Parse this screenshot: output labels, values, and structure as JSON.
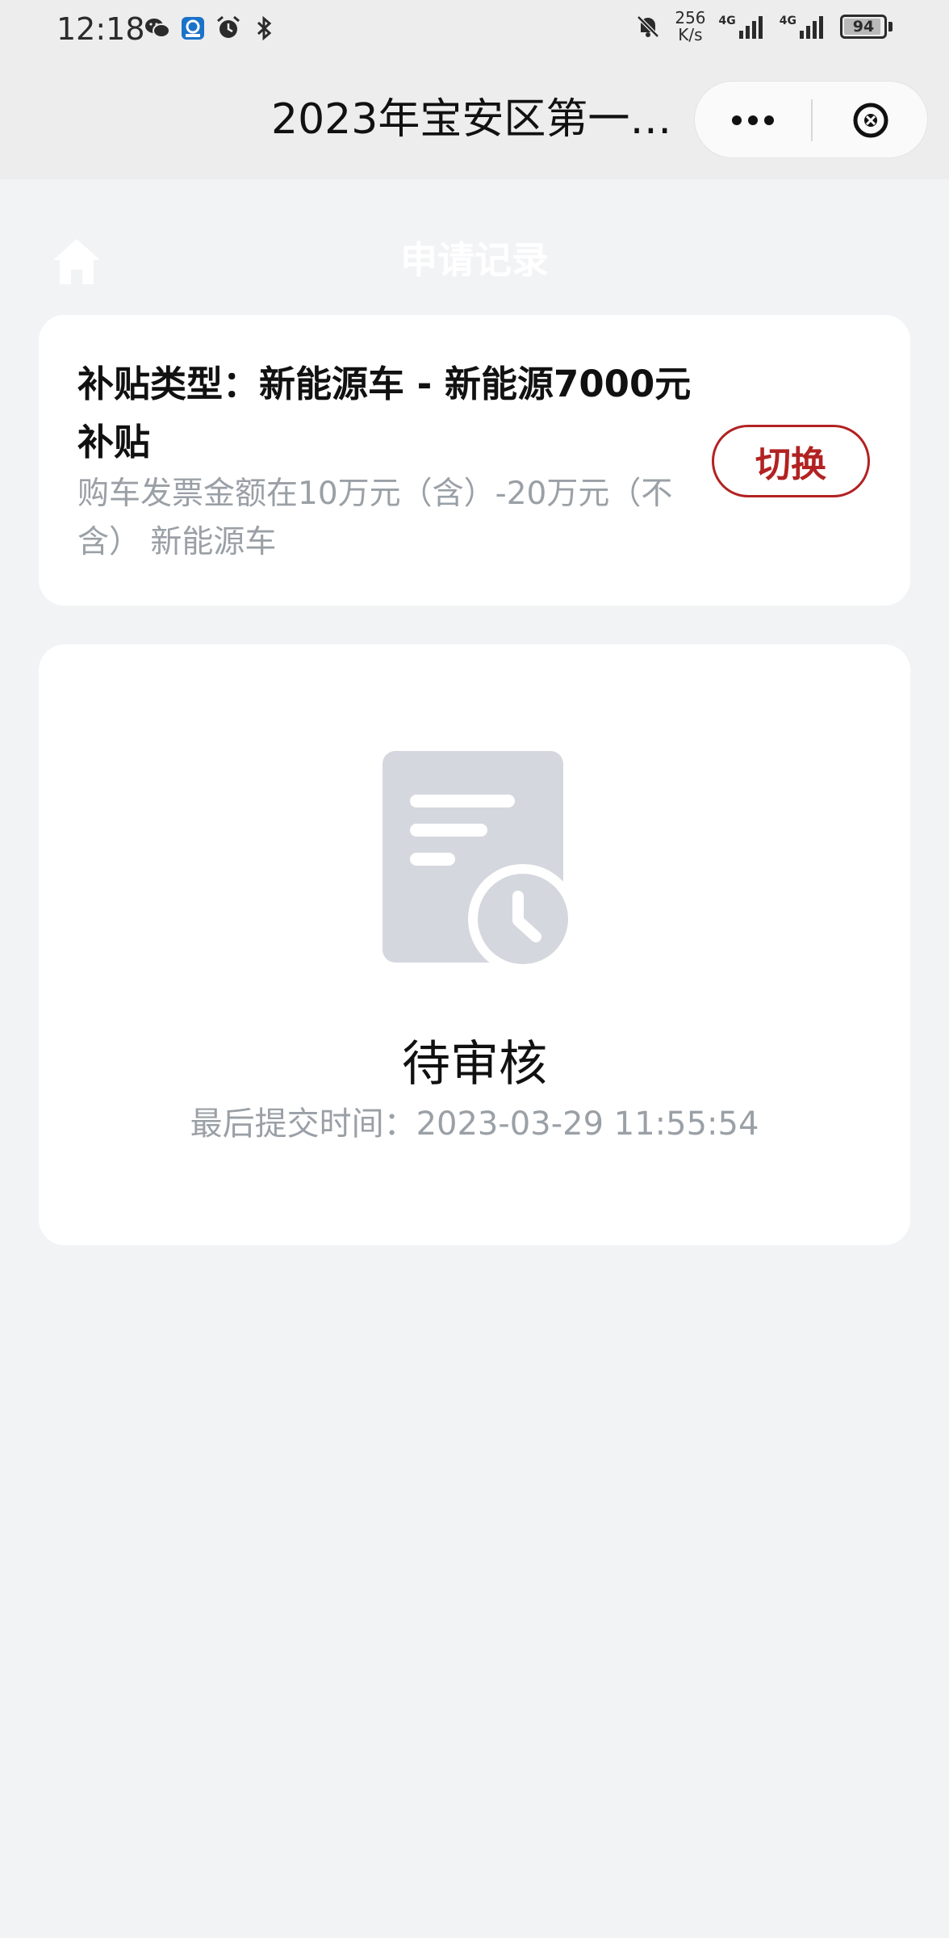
{
  "status_bar": {
    "time": "12:18",
    "net_speed_value": "256",
    "net_speed_unit": "K/s",
    "signal1_label": "4G",
    "signal2_label": "4G",
    "battery": "94",
    "battery_level": 0.94
  },
  "title_bar": {
    "title": "2023年宝安区第一…"
  },
  "header": {
    "page_title": "申请记录"
  },
  "subsidy_card": {
    "title": "补贴类型：新能源车 - 新能源7000元补贴",
    "description": "购车发票金额在10万元（含）-20万元（不含） 新能源车",
    "switch_label": "切换"
  },
  "status_card": {
    "status": "待审核",
    "submit_time": "最后提交时间：2023-03-29 11:55:54"
  },
  "colors": {
    "accent": "#b22222",
    "background": "#f2f3f5",
    "illustration": "#d5d7de"
  }
}
